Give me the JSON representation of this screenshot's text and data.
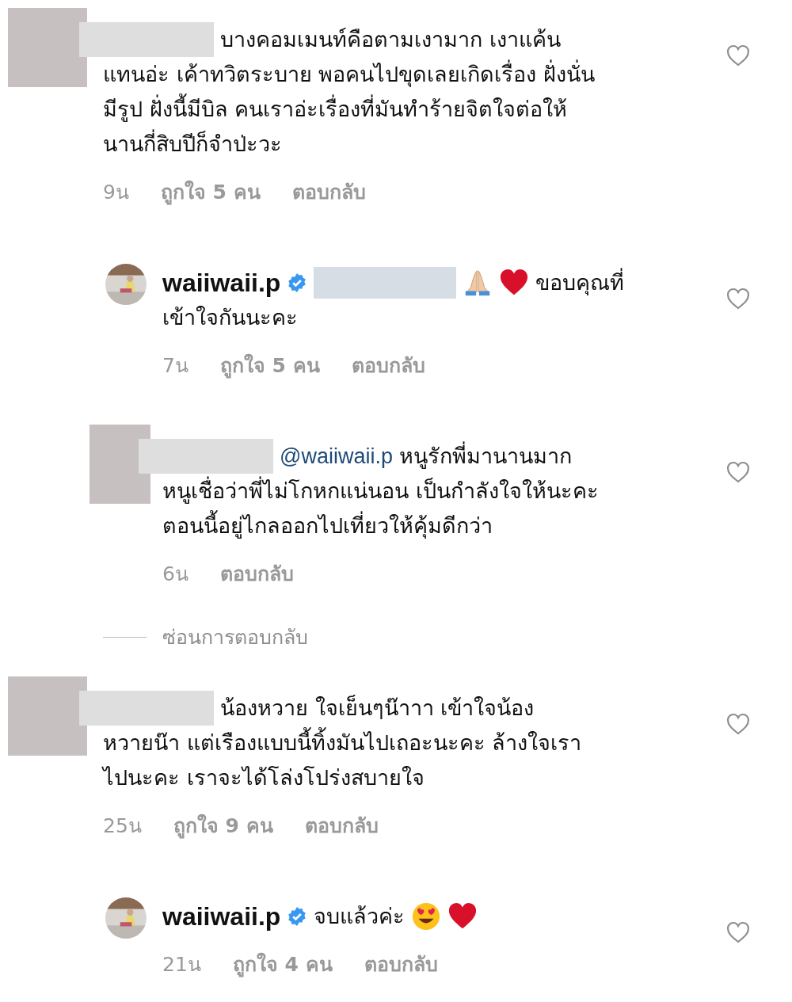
{
  "comments": [
    {
      "avatar": {
        "kind": "redacted"
      },
      "author_redacted": true,
      "content": [
        {
          "kind": "text",
          "lines": [
            "บางคอมเมนท์คือตามเงามาก เงาแค้น",
            "แทนอ่ะ เค้าทวิตระบาย พอคนไปขุดเลยเกิดเรื่อง ฝั่งนั่น",
            "มีรูป ฝั่งนี้มีบิล คนเราอ่ะเรื่องที่มันทำร้ายจิตใจต่อให้",
            "นานกี่สิบปีก็จำป่ะวะ"
          ]
        }
      ],
      "time": "9น",
      "likes": "ถูกใจ 5 คน",
      "reply": "ตอบกลับ",
      "hide_replies": "ซ่อนการตอบกลับ",
      "children": [
        {
          "avatar": {
            "kind": "photo"
          },
          "author": "waiiwaii.p",
          "verified": true,
          "content": [
            {
              "kind": "redaction"
            },
            {
              "kind": "pray"
            },
            {
              "kind": "heart"
            },
            {
              "kind": "text",
              "lines": [
                "ขอบคุณที่",
                "เข้าใจกันนะคะ"
              ]
            }
          ],
          "time": "7น",
          "likes": "ถูกใจ 5 คน",
          "reply": "ตอบกลับ"
        },
        {
          "avatar": {
            "kind": "redacted"
          },
          "author_redacted": true,
          "content": [
            {
              "kind": "mention",
              "text": "@waiiwaii.p"
            },
            {
              "kind": "text",
              "lines": [
                "หนูรักพี่มานานมาก",
                "หนูเชื่อว่าพี่ไม่โกหกแน่นอน เป็นกำลังใจให้นะคะ",
                "ตอนนี้อยู่ไกลออกไปเที่ยวให้คุ้มดีกว่า"
              ]
            }
          ],
          "time": "6น",
          "reply": "ตอบกลับ"
        }
      ]
    },
    {
      "avatar": {
        "kind": "redacted"
      },
      "author_redacted": true,
      "content": [
        {
          "kind": "text",
          "lines": [
            "น้องหวาย ใจเย็นๆน๊าาา เข้าใจน้อง",
            "หวายน๊า แต่เรืองแบบนี้ทิ้งมันไปเถอะนะคะ ล้างใจเรา",
            "ไปนะคะ เราจะได้โล่งโปร่งสบายใจ"
          ]
        }
      ],
      "time": "25น",
      "likes": "ถูกใจ 9 คน",
      "reply": "ตอบกลับ",
      "children": [
        {
          "avatar": {
            "kind": "photo"
          },
          "author": "waiiwaii.p",
          "verified": true,
          "content": [
            {
              "kind": "text",
              "lines": [
                "จบแล้วค่ะ"
              ]
            },
            {
              "kind": "heart_eyes"
            },
            {
              "kind": "heart"
            }
          ],
          "time": "21น",
          "likes": "ถูกใจ 4 คน",
          "reply": "ตอบกลับ"
        }
      ]
    }
  ]
}
